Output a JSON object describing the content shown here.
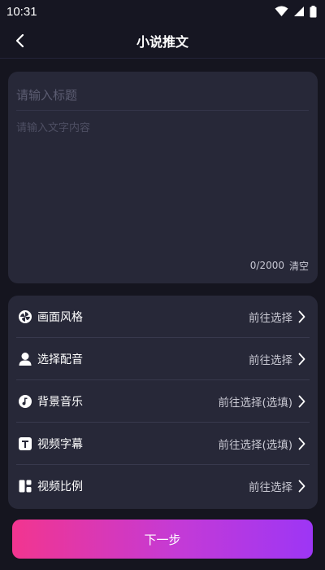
{
  "status_bar": {
    "time": "10:31",
    "icons": [
      "wifi-icon",
      "signal-icon",
      "battery-icon"
    ]
  },
  "header": {
    "title": "小说推文",
    "back_icon": "back-chevron-icon"
  },
  "editor": {
    "title_placeholder": "请输入标题",
    "title_value": "",
    "content_placeholder": "请输入文字内容",
    "content_value": "",
    "counter": "0/2000",
    "clear_label": "清空"
  },
  "options": [
    {
      "icon": "style-icon",
      "label": "画面风格",
      "value": "前往选择"
    },
    {
      "icon": "voice-icon",
      "label": "选择配音",
      "value": "前往选择"
    },
    {
      "icon": "music-icon",
      "label": "背景音乐",
      "value": "前往选择(选填)"
    },
    {
      "icon": "subtitle-icon",
      "label": "视频字幕",
      "value": "前往选择(选填)"
    },
    {
      "icon": "ratio-icon",
      "label": "视频比例",
      "value": "前往选择"
    }
  ],
  "next_button": {
    "label": "下一步"
  },
  "colors": {
    "background": "#15151f",
    "card": "#272838",
    "gradient_start": "#f2358f",
    "gradient_end": "#9d36f5"
  }
}
